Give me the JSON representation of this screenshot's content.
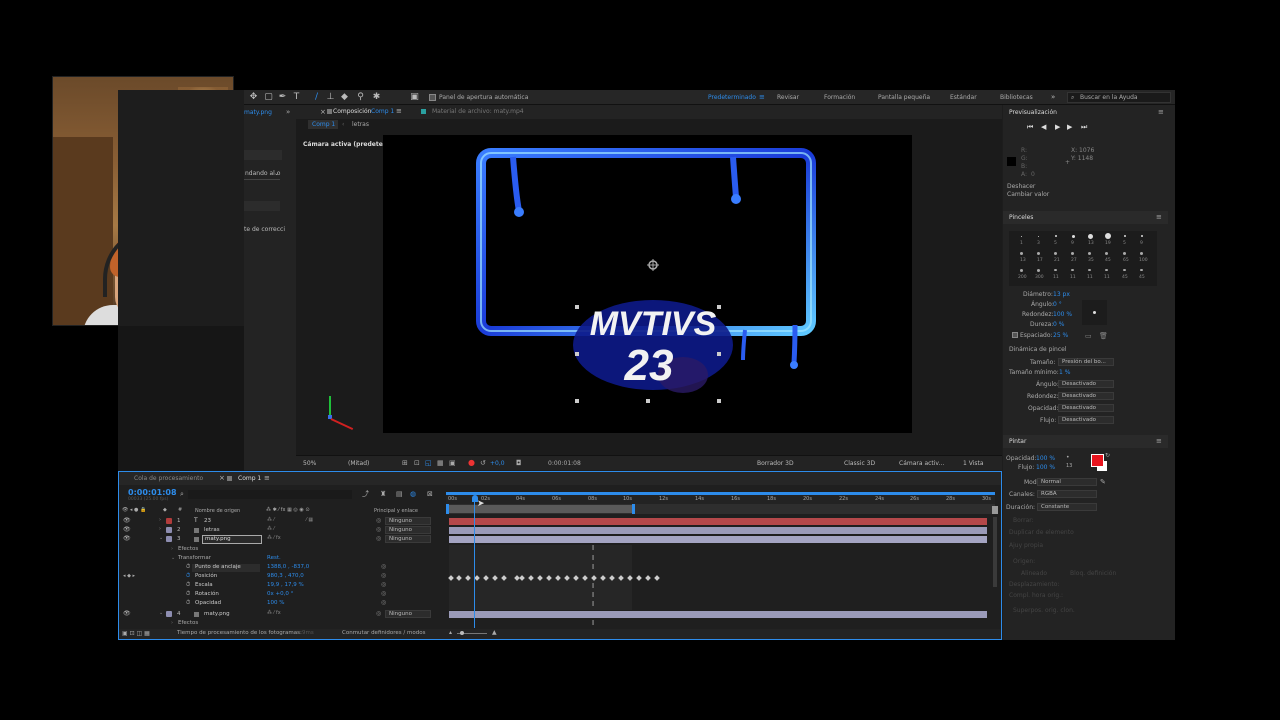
{
  "toolbar": {
    "auto_open_label": "Panel de apertura automática",
    "workspaces": [
      "Predeterminado",
      "Revisar",
      "Formación",
      "Pantalla pequeña",
      "Estándar",
      "Bibliotecas"
    ],
    "active_workspace": "Predeterminado",
    "search_placeholder": "Buscar en la Ayuda"
  },
  "project_panel": {
    "item_name": "maty.png",
    "dropdown_text": "ndando al o",
    "label_text": "te de correcci"
  },
  "composition_panel": {
    "title_prefix": "Composición",
    "title_comp": "Comp 1",
    "material_label": "Material de archivo: maty.mp4",
    "tabs": [
      "Comp 1",
      "letras"
    ],
    "camera_label": "Cámara activa (predeterminada)",
    "canvas_text_top": "MVTIVS",
    "canvas_text_bottom": "23"
  },
  "viewer_bar": {
    "zoom": "50%",
    "resolution": "(Mitad)",
    "exposure": "+0,0",
    "timecode": "0:00:01:08",
    "renderer": "Borrador 3D",
    "renderer_mode": "Classic 3D",
    "camera": "Cámara activ...",
    "views": "1 Vista"
  },
  "right_panel": {
    "preview_title": "Previsualización",
    "info": {
      "R": "R:",
      "G": "G:",
      "B": "B:",
      "A": "A:",
      "A_val": "0",
      "X": "X: 1076",
      "Y": "Y: 1148"
    },
    "undo_label": "Deshacer",
    "undo_action": "Cambiar valor",
    "brushes_title": "Pinceles",
    "brush_sizes_row1": [
      "1",
      "3",
      "5",
      "9",
      "13",
      "19",
      "5",
      "9"
    ],
    "brush_sizes_row2": [
      "13",
      "17",
      "21",
      "27",
      "35",
      "45",
      "65",
      "100"
    ],
    "brush_sizes_row3": [
      "200",
      "300",
      "11",
      "11",
      "11",
      "11",
      "45",
      "45"
    ],
    "brush_params": [
      {
        "label": "Diámetro:",
        "value": "13 px"
      },
      {
        "label": "Ángulo:",
        "value": "0 °"
      },
      {
        "label": "Redondez:",
        "value": "100 %"
      },
      {
        "label": "Dureza:",
        "value": "0 %"
      },
      {
        "label": "Espaciado:",
        "value": "25 %"
      }
    ],
    "dynamics_title": "Dinámica de pincel",
    "dynamics": [
      {
        "label": "Tamaño:",
        "value": "Presión del bo..."
      },
      {
        "label": "Tamaño mínimo:",
        "value": "1 %"
      },
      {
        "label": "Ángulo:",
        "value": "Desactivado"
      },
      {
        "label": "Redondez:",
        "value": "Desactivado"
      },
      {
        "label": "Opacidad:",
        "value": "Desactivado"
      },
      {
        "label": "Flujo:",
        "value": "Desactivado"
      }
    ],
    "paint_title": "Pintar",
    "paint": [
      {
        "label": "Opacidad:",
        "value": "100 %"
      },
      {
        "label": "Flujo:",
        "value": "100 %"
      },
      {
        "label": "Modo:",
        "value": "Normal"
      },
      {
        "label": "Canales:",
        "value": "RGBA"
      },
      {
        "label": "Duración:",
        "value": "Constante"
      }
    ],
    "paint_size": "13",
    "disabled_rows": [
      "Borrar:",
      "Duplicar de elemento",
      "Ajuy propia",
      "Origen:",
      "Alineado",
      "Bloq. definición",
      "Desplazamiento:",
      "Compl. hora orig.:",
      "Superpos. orig. clon."
    ],
    "fg_color": "#e8141e",
    "bg_color": "#ffffff"
  },
  "timeline": {
    "tabs": [
      "Cola de procesamiento",
      "Comp 1"
    ],
    "timecode": "0:00:01:08",
    "timecode_sub": "00033 (25.00 fps)",
    "col_source": "Nombre de origen",
    "col_parent": "Principal y enlace",
    "ruler": [
      "00s",
      "02s",
      "04s",
      "06s",
      "08s",
      "10s",
      "12s",
      "14s",
      "16s",
      "18s",
      "20s",
      "22s",
      "24s",
      "26s",
      "28s",
      "30s"
    ],
    "layers": [
      {
        "num": "1",
        "type": "T",
        "name": "23",
        "parent": "Ninguno",
        "color": "#b13c3c"
      },
      {
        "num": "2",
        "type": "img",
        "name": "letras",
        "parent": "Ninguno",
        "color": "#8d8db0"
      },
      {
        "num": "3",
        "type": "img",
        "name": "maty.png",
        "parent": "Ninguno",
        "color": "#8d8db0"
      },
      {
        "num": "4",
        "type": "img",
        "name": "maty.png",
        "parent": "Ninguno",
        "color": "#8d8db0"
      }
    ],
    "effects_label": "Efectos",
    "transform_label": "Transformar",
    "reset_label": "Rest.",
    "properties": [
      {
        "name": "Punto de anclaje",
        "value": "1388,0 , -837,0"
      },
      {
        "name": "Posición",
        "value": "980,3 , 470,0"
      },
      {
        "name": "Escala",
        "value": "19,9 , 17,9 %"
      },
      {
        "name": "Rotación",
        "value": "0x +0,0 °"
      },
      {
        "name": "Opacidad",
        "value": "100 %"
      }
    ],
    "bottom_left": "Tiempo de procesamiento de los fotogramas:",
    "bottom_left_val": "9ms",
    "bottom_mid": "Conmutar definidores / modos"
  }
}
